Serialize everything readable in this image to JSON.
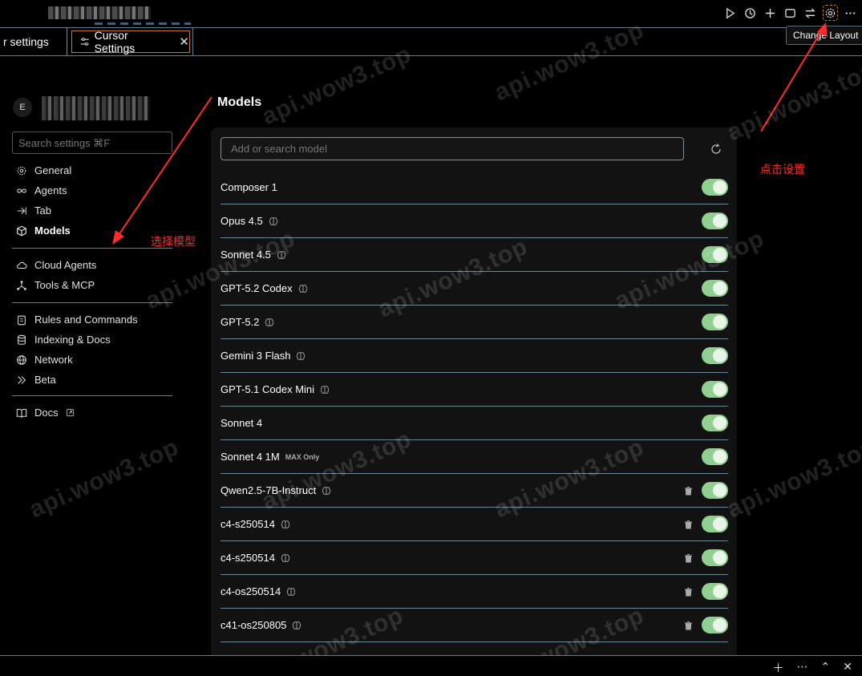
{
  "topbar": {
    "tooltip": "Change Layout",
    "icons": [
      "play-icon",
      "history-icon",
      "plus-icon",
      "layout-icon",
      "swap-icon",
      "gear-icon",
      "more-icon"
    ]
  },
  "tabs": [
    {
      "label": "r settings"
    },
    {
      "label": "Cursor Settings",
      "close": "✕"
    }
  ],
  "sidebar": {
    "avatar_letter": "E",
    "search_placeholder": "Search settings ⌘F",
    "groups": [
      [
        {
          "label": "General",
          "icon": "gear-icon"
        },
        {
          "label": "Agents",
          "icon": "infinity-icon"
        },
        {
          "label": "Tab",
          "icon": "tab-arrow-icon"
        },
        {
          "label": "Models",
          "icon": "cube-icon",
          "active": true
        }
      ],
      [
        {
          "label": "Cloud Agents",
          "icon": "cloud-icon"
        },
        {
          "label": "Tools & MCP",
          "icon": "nodes-icon"
        }
      ],
      [
        {
          "label": "Rules and Commands",
          "icon": "clipboard-icon"
        },
        {
          "label": "Indexing & Docs",
          "icon": "database-icon"
        },
        {
          "label": "Network",
          "icon": "globe-icon"
        },
        {
          "label": "Beta",
          "icon": "chevrons-icon"
        }
      ],
      [
        {
          "label": "Docs",
          "icon": "book-icon",
          "external": true
        }
      ]
    ]
  },
  "main": {
    "title": "Models",
    "input_placeholder": "Add or search model",
    "models": [
      {
        "name": "Composer 1",
        "brain": false,
        "trash": false,
        "enabled": true
      },
      {
        "name": "Opus 4.5",
        "brain": true,
        "trash": false,
        "enabled": true
      },
      {
        "name": "Sonnet 4.5",
        "brain": true,
        "trash": false,
        "enabled": true
      },
      {
        "name": "GPT-5.2 Codex",
        "brain": true,
        "trash": false,
        "enabled": true
      },
      {
        "name": "GPT-5.2",
        "brain": true,
        "trash": false,
        "enabled": true
      },
      {
        "name": "Gemini 3 Flash",
        "brain": true,
        "trash": false,
        "enabled": true
      },
      {
        "name": "GPT-5.1 Codex Mini",
        "brain": true,
        "trash": false,
        "enabled": true
      },
      {
        "name": "Sonnet 4",
        "brain": false,
        "trash": false,
        "enabled": true
      },
      {
        "name": "Sonnet 4 1M",
        "brain": false,
        "badge": "MAX Only",
        "trash": false,
        "enabled": true
      },
      {
        "name": "Qwen2.5-7B-Instruct",
        "brain": true,
        "trash": true,
        "enabled": true
      },
      {
        "name": "c4-s250514",
        "brain": true,
        "trash": true,
        "enabled": true
      },
      {
        "name": "c4-s250514",
        "brain": true,
        "trash": true,
        "enabled": true
      },
      {
        "name": "c4-os250514",
        "brain": true,
        "trash": true,
        "enabled": true
      },
      {
        "name": "c41-os250805",
        "brain": true,
        "trash": true,
        "enabled": true
      }
    ]
  },
  "annotations": {
    "select_model": "选择模型",
    "click_settings": "点击设置",
    "watermark": "api.wow3.top",
    "arrow_color": "#ff2b2b"
  }
}
